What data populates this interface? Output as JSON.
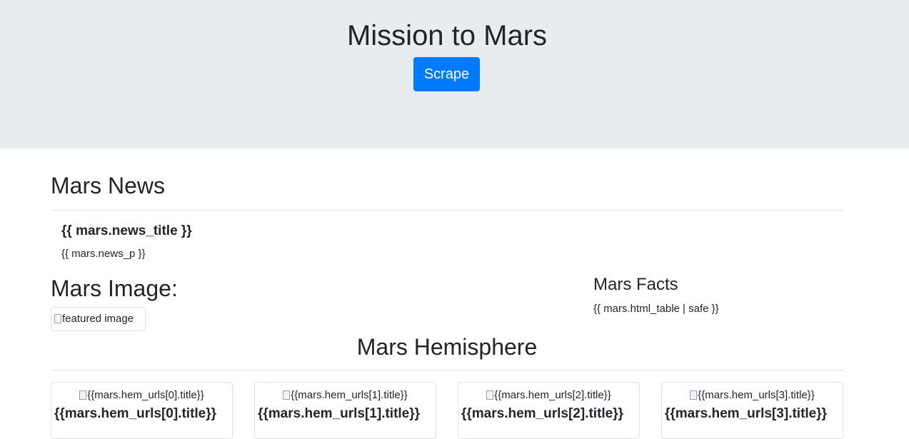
{
  "header": {
    "title": "Mission to Mars",
    "scrape_label": "Scrape"
  },
  "news": {
    "heading": "Mars News",
    "title": "{{ mars.news_title }}",
    "paragraph": "{{ mars.news_p }}"
  },
  "image": {
    "heading": "Mars Image:",
    "alt": "featured image"
  },
  "facts": {
    "heading": "Mars Facts",
    "table": "{{ mars.html_table | safe }}"
  },
  "hemispheres": {
    "heading": "Mars Hemisphere",
    "cards": [
      {
        "alt": "{{mars.hem_urls[0].title}}",
        "title": "{{mars.hem_urls[0].title}}"
      },
      {
        "alt": "{{mars.hem_urls[1].title}}",
        "title": "{{mars.hem_urls[1].title}}"
      },
      {
        "alt": "{{mars.hem_urls[2].title}}",
        "title": "{{mars.hem_urls[2].title}}"
      },
      {
        "alt": "{{mars.hem_urls[3].title}}",
        "title": "{{mars.hem_urls[3].title}}"
      }
    ]
  },
  "colors": {
    "jumbotron_bg": "#e9ecef",
    "primary_button": "#007bff",
    "text": "#212529",
    "rule": "#dee2e6"
  },
  "icons": [
    "broken-image-icon"
  ]
}
